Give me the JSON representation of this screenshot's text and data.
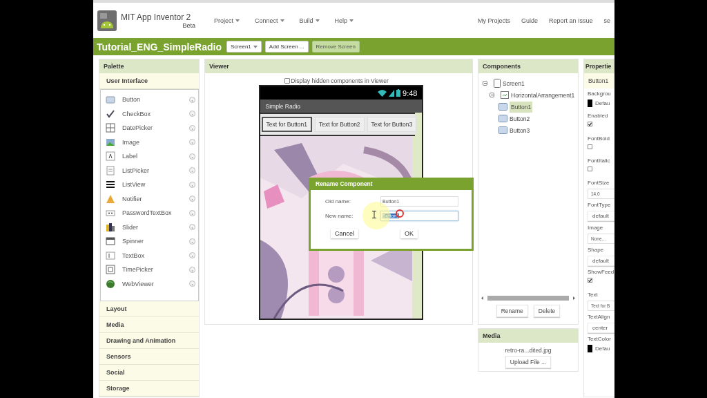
{
  "header": {
    "app_name": "MIT App Inventor 2",
    "edition": "Beta",
    "menus": [
      "Project",
      "Connect",
      "Build",
      "Help"
    ],
    "links": [
      "My Projects",
      "Guide",
      "Report an Issue",
      "se"
    ]
  },
  "project_bar": {
    "title": "Tutorial_ENG_SimpleRadio",
    "screen_dropdown": "Screen1",
    "buttons": [
      {
        "label": "Add Screen ...",
        "disabled": false
      },
      {
        "label": "Remove Screen",
        "disabled": true
      }
    ]
  },
  "palette": {
    "title": "Palette",
    "open_section": "User Interface",
    "items": [
      "Button",
      "CheckBox",
      "DatePicker",
      "Image",
      "Label",
      "ListPicker",
      "ListView",
      "Notifier",
      "PasswordTextBox",
      "Slider",
      "Spinner",
      "TextBox",
      "TimePicker",
      "WebViewer"
    ],
    "sections": [
      "Layout",
      "Media",
      "Drawing and Animation",
      "Sensors",
      "Social",
      "Storage"
    ]
  },
  "viewer": {
    "title": "Viewer",
    "hidden_checkbox": {
      "label": "Display hidden components in Viewer",
      "checked": false
    },
    "phone": {
      "time": "9:48",
      "screen_title": "Simple Radio",
      "buttons": [
        {
          "label": "Text for Button1",
          "selected": true
        },
        {
          "label": "Text for Button2",
          "selected": false
        },
        {
          "label": "Text for Button3",
          "selected": false
        }
      ]
    }
  },
  "dialog": {
    "title": "Rename Component",
    "old_label": "Old name:",
    "old_value": "Button1",
    "new_label": "New name:",
    "new_value": "Button1",
    "buttons": [
      "Cancel",
      "OK"
    ]
  },
  "components": {
    "title": "Components",
    "tree": [
      {
        "label": "Screen1",
        "kind": "screen",
        "expanded": true,
        "selected": false,
        "children": [
          {
            "label": "HorizontalArrangement1",
            "kind": "arrangement",
            "expanded": true,
            "selected": false,
            "children": [
              {
                "label": "Button1",
                "kind": "button",
                "selected": true
              },
              {
                "label": "Button2",
                "kind": "button",
                "selected": false
              },
              {
                "label": "Button3",
                "kind": "button",
                "selected": false
              }
            ]
          }
        ]
      }
    ],
    "buttons": [
      "Rename",
      "Delete"
    ]
  },
  "media": {
    "title": "Media",
    "files": [
      "retro-ra...dited.jpg"
    ],
    "upload": "Upload File ..."
  },
  "properties": {
    "title": "Propertie",
    "component": "Button1",
    "items": [
      {
        "label": "Backgrou",
        "kind": "color",
        "color": "#000000",
        "value": "Defau"
      },
      {
        "label": "Enabled",
        "kind": "checkbox",
        "checked": true
      },
      {
        "label": "FontBold",
        "kind": "checkbox",
        "checked": false
      },
      {
        "label": "FontItalic",
        "kind": "checkbox",
        "checked": false
      },
      {
        "label": "FontSize",
        "kind": "field",
        "value": "14.0"
      },
      {
        "label": "FontType",
        "kind": "choice",
        "value": "default"
      },
      {
        "label": "Image",
        "kind": "field",
        "value": "None..."
      },
      {
        "label": "Shape",
        "kind": "choice",
        "value": "default"
      },
      {
        "label": "ShowFeed",
        "kind": "checkbox",
        "checked": true
      },
      {
        "label": "Text",
        "kind": "field",
        "value": "Text for B"
      },
      {
        "label": "TextAlign",
        "kind": "choice",
        "value": "center"
      },
      {
        "label": "TextColor",
        "kind": "color",
        "color": "#000000",
        "value": "Defau"
      }
    ]
  }
}
